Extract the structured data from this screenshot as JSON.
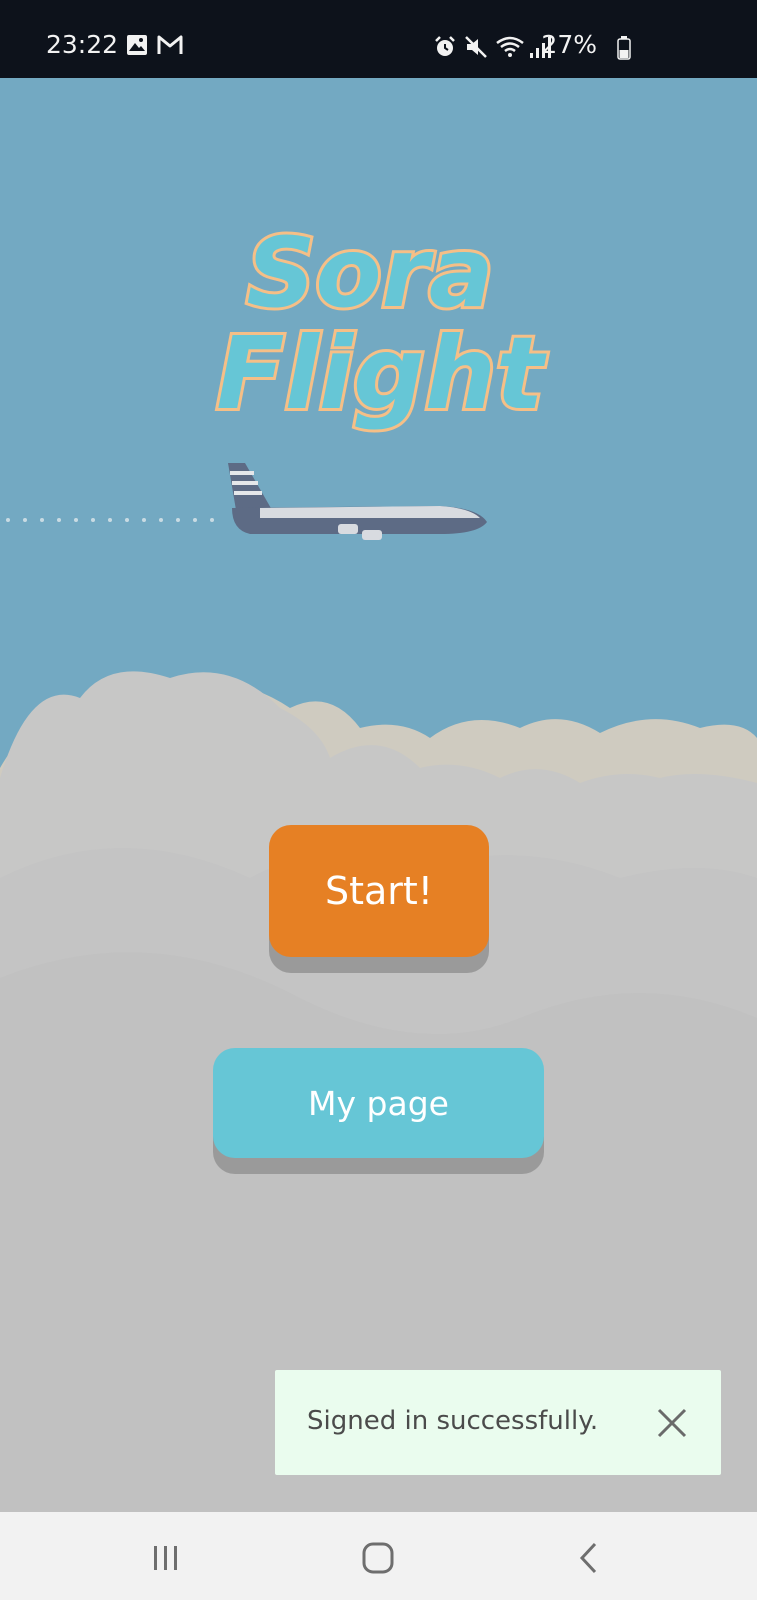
{
  "status_bar": {
    "time": "23:22",
    "battery": "27%",
    "icons": [
      "gallery-icon",
      "gmail-icon",
      "alarm-icon",
      "mute-icon",
      "wifi-icon",
      "signal-icon",
      "battery-icon"
    ]
  },
  "app": {
    "logo_line1": "Sora",
    "logo_line2": "Flight"
  },
  "buttons": {
    "start_label": "Start!",
    "mypage_label": "My page"
  },
  "toast": {
    "message": "Signed in successfully."
  },
  "nav": {
    "icons": [
      "recents-icon",
      "home-icon",
      "back-icon"
    ]
  },
  "colors": {
    "sky": "#73a9c2",
    "start_button": "#e68024",
    "mypage_button": "#66c6d6",
    "logo_fill": "#66c6d6",
    "logo_outline": "#f5bf87",
    "toast_bg": "#eafcee"
  }
}
